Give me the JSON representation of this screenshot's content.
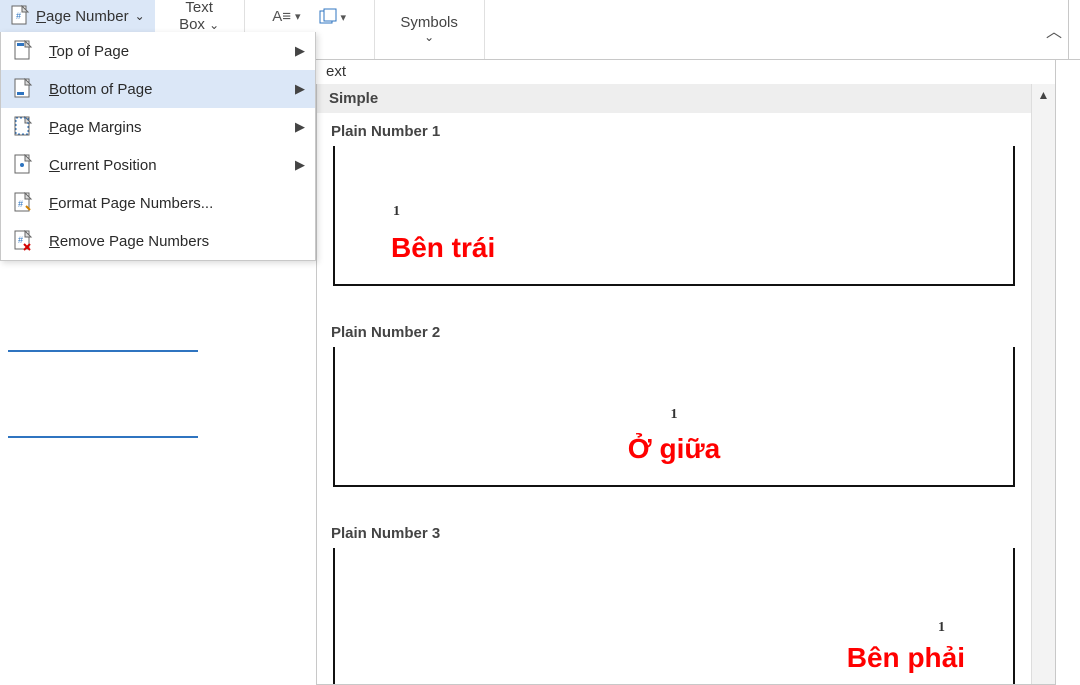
{
  "ribbon": {
    "page_number_label": "Page Number",
    "text_box_top": "Text",
    "text_box_bottom": "Box",
    "symbols_label": "Symbols",
    "text_group_label": "ext"
  },
  "menu": {
    "items": [
      {
        "label": "Top of Page",
        "has_submenu": true,
        "icon": "page-top"
      },
      {
        "label": "Bottom of Page",
        "has_submenu": true,
        "icon": "page-bottom",
        "hover": true
      },
      {
        "label": "Page Margins",
        "has_submenu": true,
        "icon": "page-margins"
      },
      {
        "label": "Current Position",
        "has_submenu": true,
        "icon": "page-current"
      },
      {
        "label": "Format Page Numbers...",
        "has_submenu": false,
        "icon": "page-format"
      },
      {
        "label": "Remove Page Numbers",
        "has_submenu": false,
        "icon": "page-remove"
      }
    ]
  },
  "gallery": {
    "header": "Simple",
    "options": [
      {
        "title": "Plain Number 1",
        "num": "1",
        "pos": "left",
        "annotation": "Bên trái"
      },
      {
        "title": "Plain Number 2",
        "num": "1",
        "pos": "center",
        "annotation": "Ở giữa"
      },
      {
        "title": "Plain Number 3",
        "num": "1",
        "pos": "right",
        "annotation": "Bên phải"
      }
    ]
  }
}
